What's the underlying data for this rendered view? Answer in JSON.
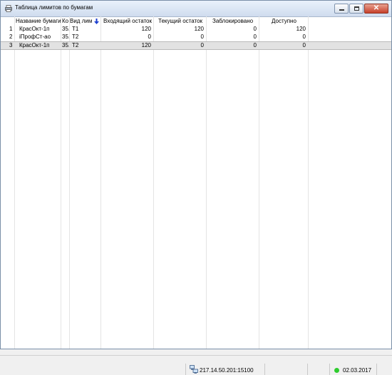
{
  "window": {
    "title": "Таблица лимитов по бумагам",
    "close_glyph": "✕"
  },
  "table": {
    "columns": [
      "",
      "Название бумаги",
      "Ко",
      "Вид лим",
      "Входящий остаток",
      "Текущий остаток",
      "Заблокировано",
      "Доступно"
    ],
    "rows": [
      {
        "n": "1",
        "name": "КрасОкт-1п",
        "code": "35.",
        "type": "T1",
        "in": "120",
        "cur": "120",
        "blocked": "0",
        "avail": "120"
      },
      {
        "n": "2",
        "name": "iПрофСт-ао",
        "code": "35.",
        "type": "T2",
        "in": "0",
        "cur": "0",
        "blocked": "0",
        "avail": "0"
      },
      {
        "n": "3",
        "name": "КрасОкт-1п",
        "code": "35.",
        "type": "T2",
        "in": "120",
        "cur": "0",
        "blocked": "0",
        "avail": "0"
      }
    ],
    "selected_row": 3,
    "sort_icon": "sort-desc-arrow"
  },
  "statusbar": {
    "server": "217.14.50.201:15100",
    "date": "02.03.2017",
    "connection_color": "#2ecc2e"
  }
}
